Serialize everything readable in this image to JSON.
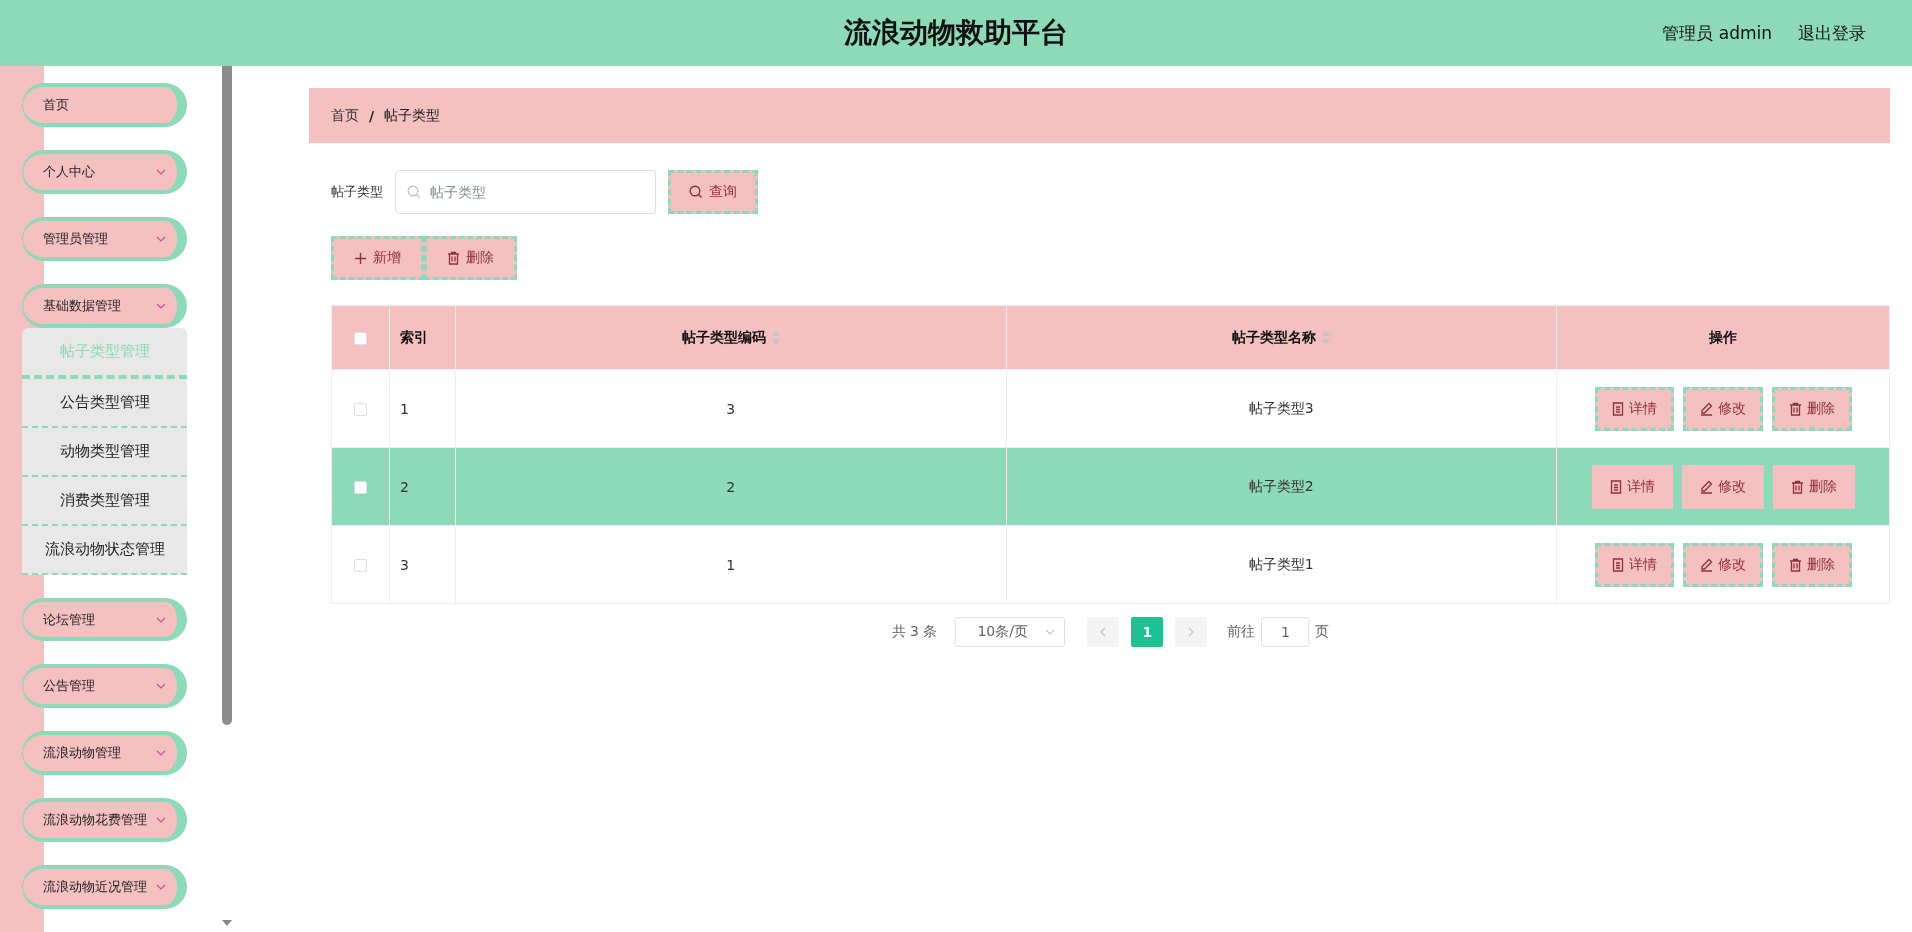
{
  "header": {
    "title": "流浪动物救助平台",
    "user": "管理员 admin",
    "logout": "退出登录"
  },
  "sidebar": {
    "items": [
      {
        "label": "首页",
        "kind": "link"
      },
      {
        "label": "个人中心",
        "kind": "menu",
        "expanded": false
      },
      {
        "label": "管理员管理",
        "kind": "menu",
        "expanded": false
      },
      {
        "label": "基础数据管理",
        "kind": "menu",
        "expanded": true,
        "children": [
          {
            "label": "帖子类型管理",
            "selected": true
          },
          {
            "label": "公告类型管理",
            "selected": false
          },
          {
            "label": "动物类型管理",
            "selected": false
          },
          {
            "label": "消费类型管理",
            "selected": false
          },
          {
            "label": "流浪动物状态管理",
            "selected": false
          }
        ]
      },
      {
        "label": "论坛管理",
        "kind": "menu",
        "expanded": false
      },
      {
        "label": "公告管理",
        "kind": "menu",
        "expanded": false
      },
      {
        "label": "流浪动物管理",
        "kind": "menu",
        "expanded": false
      },
      {
        "label": "流浪动物花费管理",
        "kind": "menu",
        "expanded": false
      },
      {
        "label": "流浪动物近况管理",
        "kind": "menu",
        "expanded": false
      }
    ]
  },
  "breadcrumb": [
    "首页",
    "帖子类型"
  ],
  "breadcrumb_separator": "/",
  "search": {
    "label": "帖子类型",
    "placeholder": "帖子类型",
    "button": "查询"
  },
  "toolbar": [
    {
      "label": "新增",
      "kind": "add"
    },
    {
      "label": "删除",
      "kind": "delete"
    }
  ],
  "table": {
    "select_all_checked": false,
    "columns": [
      {
        "label": "索引",
        "sortable": false
      },
      {
        "label": "帖子类型编码",
        "sortable": true
      },
      {
        "label": "帖子类型名称",
        "sortable": true
      },
      {
        "label": "操作",
        "sortable": false
      }
    ],
    "rows": [
      {
        "checked": false,
        "selected": false,
        "cells": [
          "1",
          "3",
          "帖子类型3"
        ],
        "actions": [
          {
            "label": "详情",
            "kind": "detail"
          },
          {
            "label": "修改",
            "kind": "edit"
          },
          {
            "label": "删除",
            "kind": "delete"
          }
        ]
      },
      {
        "checked": false,
        "selected": true,
        "cells": [
          "2",
          "2",
          "帖子类型2"
        ],
        "actions": [
          {
            "label": "详情",
            "kind": "detail"
          },
          {
            "label": "修改",
            "kind": "edit"
          },
          {
            "label": "删除",
            "kind": "delete"
          }
        ]
      },
      {
        "checked": false,
        "selected": false,
        "cells": [
          "3",
          "1",
          "帖子类型1"
        ],
        "actions": [
          {
            "label": "详情",
            "kind": "detail"
          },
          {
            "label": "修改",
            "kind": "edit"
          },
          {
            "label": "删除",
            "kind": "delete"
          }
        ]
      }
    ]
  },
  "pagination": {
    "total": "共 3 条",
    "page_size": "10条/页",
    "pages": [
      {
        "label": "1",
        "selected": true
      }
    ],
    "goto_label": "前往",
    "goto_value": "1",
    "goto_suffix": "页"
  }
}
